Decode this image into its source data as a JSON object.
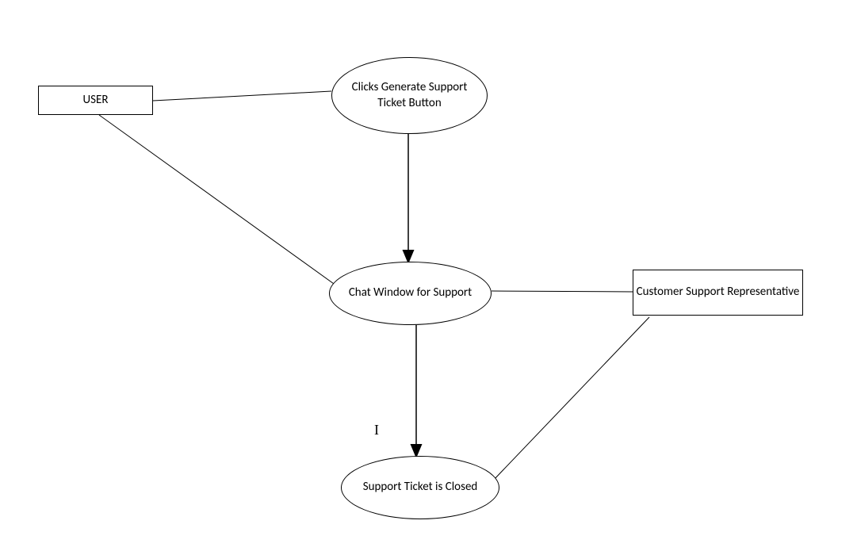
{
  "nodes": {
    "user": "USER",
    "clicks_generate": "Clicks Generate Support Ticket Button",
    "chat_window": "Chat Window for Support",
    "customer_rep": "Customer Support Representative",
    "ticket_closed": "Support Ticket is Closed"
  },
  "cursor": "I"
}
